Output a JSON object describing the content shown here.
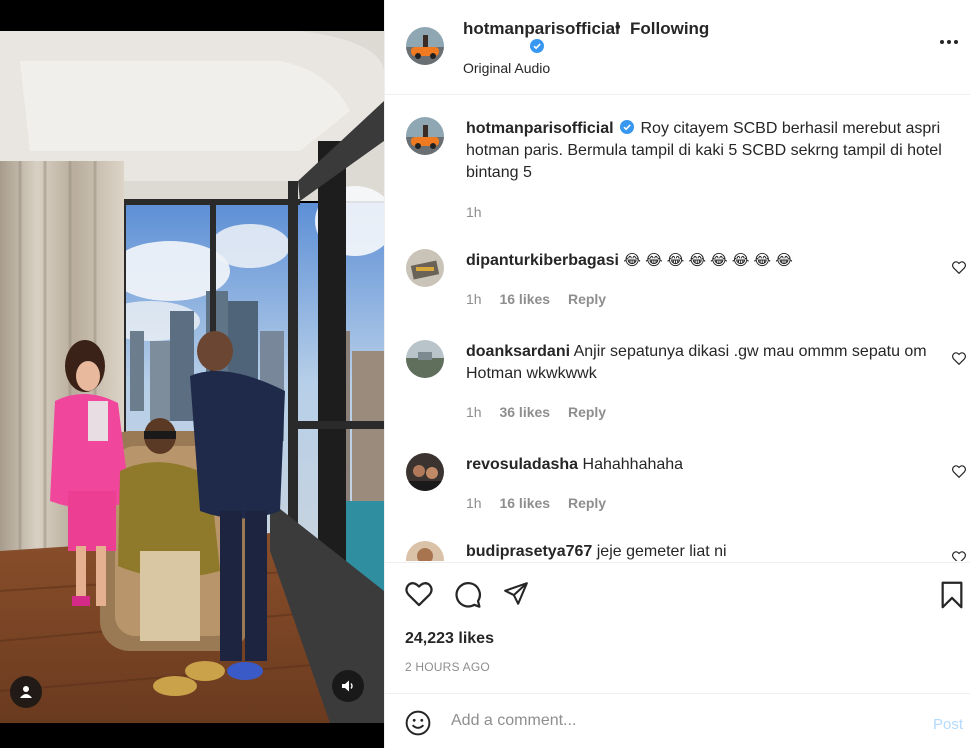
{
  "post": {
    "username": "hotmanparisofficial",
    "verified": true,
    "separator": "•",
    "follow_status": "Following",
    "audio": "Original Audio",
    "likes": "24,223 likes",
    "posted_ago": "2 HOURS AGO"
  },
  "caption": {
    "username": "hotmanparisofficial",
    "text": "Roy citayem SCBD berhasil merebut aspri hotman paris. Bermula tampil di kaki 5 SCBD sekrng tampil di hotel bintang 5",
    "time": "1h"
  },
  "comments": [
    {
      "username": "dipanturkiberbagasi",
      "text": "😂 😂 😂 😂 😂 😂 😂 😂",
      "time": "1h",
      "likes": "16 likes",
      "reply": "Reply"
    },
    {
      "username": "doanksardani",
      "text": "Anjir sepatunya dikasi .gw mau ommm sepatu om Hotman wkwkwwk",
      "time": "1h",
      "likes": "36 likes",
      "reply": "Reply"
    },
    {
      "username": "revosuladasha",
      "text": "Hahahhahaha",
      "time": "1h",
      "likes": "16 likes",
      "reply": "Reply"
    },
    {
      "username": "budiprasetya767",
      "text": "jeje gemeter liat ni",
      "time": "",
      "likes": "",
      "reply": ""
    }
  ],
  "add_comment": {
    "placeholder": "Add a comment...",
    "post_label": "Post"
  },
  "icons": {
    "like": "heart-icon",
    "comment": "comment-icon",
    "share": "share-icon",
    "save": "bookmark-icon",
    "more": "more-options-icon",
    "emoji": "emoji-icon",
    "user_tag": "user-tag-icon",
    "mute": "speaker-icon"
  },
  "colors": {
    "verified_blue": "#3897f0",
    "post_disabled": "#b3dbff",
    "secondary_text": "#8e8e8e",
    "primary_text": "#262626"
  }
}
